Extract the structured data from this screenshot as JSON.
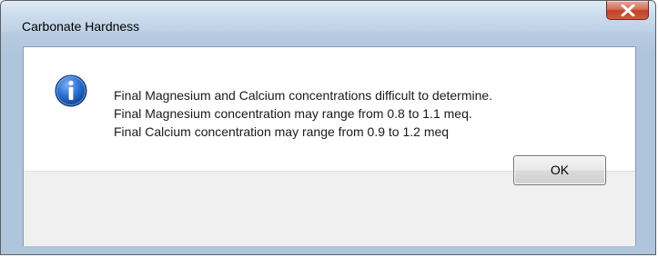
{
  "window": {
    "title": "Carbonate Hardness",
    "close_icon": "close-icon"
  },
  "dialog": {
    "icon": "info-icon",
    "message_lines": [
      "Final Magnesium and Calcium concentrations difficult to determine.",
      "Final Magnesium concentration may range from 0.8 to 1.1 meq.",
      "Final Calcium concentration may range from 0.9 to 1.2 meq"
    ],
    "ok_label": "OK"
  },
  "colors": {
    "titlebar": "#c6d8ea",
    "close_button": "#c0402a",
    "info_icon": "#1f5fc2",
    "footer": "#f0f0f0"
  }
}
